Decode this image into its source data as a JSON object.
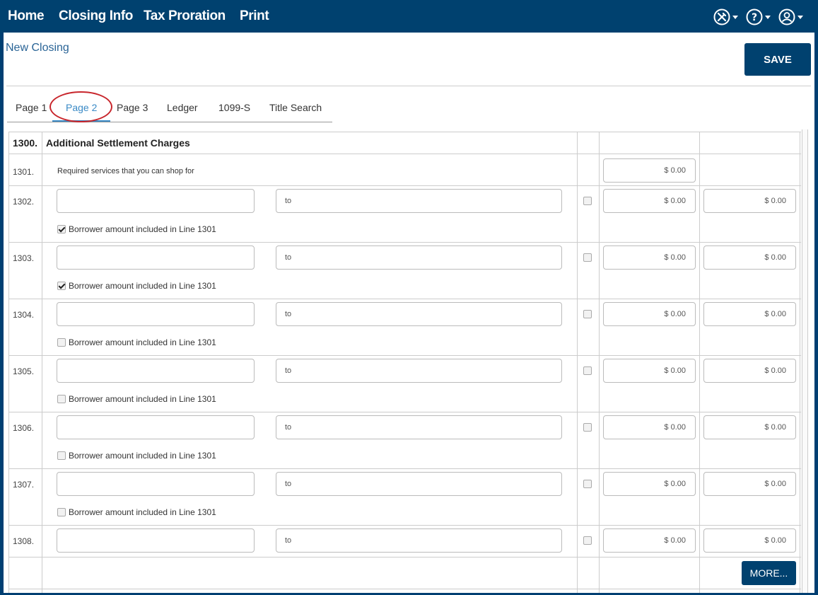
{
  "nav": {
    "home": "Home",
    "closing_info": "Closing Info",
    "tax_proration": "Tax Proration",
    "print": "Print",
    "icons": [
      "tools-icon",
      "help-icon",
      "user-icon"
    ]
  },
  "page": {
    "title": "New Closing",
    "save_label": "SAVE",
    "more_label": "MORE..."
  },
  "tabs": [
    {
      "label": "Page 1",
      "active": false
    },
    {
      "label": "Page 2",
      "active": true
    },
    {
      "label": "Page 3",
      "active": false
    },
    {
      "label": "Ledger",
      "active": false
    },
    {
      "label": "1099-S",
      "active": false
    },
    {
      "label": "Title Search",
      "active": false
    }
  ],
  "section": {
    "number": "1300.",
    "title": "Additional Settlement Charges",
    "line1301": {
      "number": "1301.",
      "description": "Required services that you can shop for",
      "amount": "$ 0.00"
    },
    "rows": [
      {
        "number": "1302.",
        "name": "",
        "to": "to",
        "paid": false,
        "borrower": "$ 0.00",
        "seller": "$ 0.00",
        "included_label": "Borrower amount included in Line 1301",
        "included": true
      },
      {
        "number": "1303.",
        "name": "",
        "to": "to",
        "paid": false,
        "borrower": "$ 0.00",
        "seller": "$ 0.00",
        "included_label": "Borrower amount included in Line 1301",
        "included": true
      },
      {
        "number": "1304.",
        "name": "",
        "to": "to",
        "paid": false,
        "borrower": "$ 0.00",
        "seller": "$ 0.00",
        "included_label": "Borrower amount included in Line 1301",
        "included": false
      },
      {
        "number": "1305.",
        "name": "",
        "to": "to",
        "paid": false,
        "borrower": "$ 0.00",
        "seller": "$ 0.00",
        "included_label": "Borrower amount included in Line 1301",
        "included": false
      },
      {
        "number": "1306.",
        "name": "",
        "to": "to",
        "paid": false,
        "borrower": "$ 0.00",
        "seller": "$ 0.00",
        "included_label": "Borrower amount included in Line 1301",
        "included": false
      },
      {
        "number": "1307.",
        "name": "",
        "to": "to",
        "paid": false,
        "borrower": "$ 0.00",
        "seller": "$ 0.00",
        "included_label": "Borrower amount included in Line 1301",
        "included": false
      },
      {
        "number": "1308.",
        "name": "",
        "to": "to",
        "paid": false,
        "borrower": "$ 0.00",
        "seller": "$ 0.00"
      }
    ]
  },
  "colors": {
    "nav_bg": "#00416f",
    "accent": "#3a8ac6",
    "highlight": "#c8262c"
  }
}
